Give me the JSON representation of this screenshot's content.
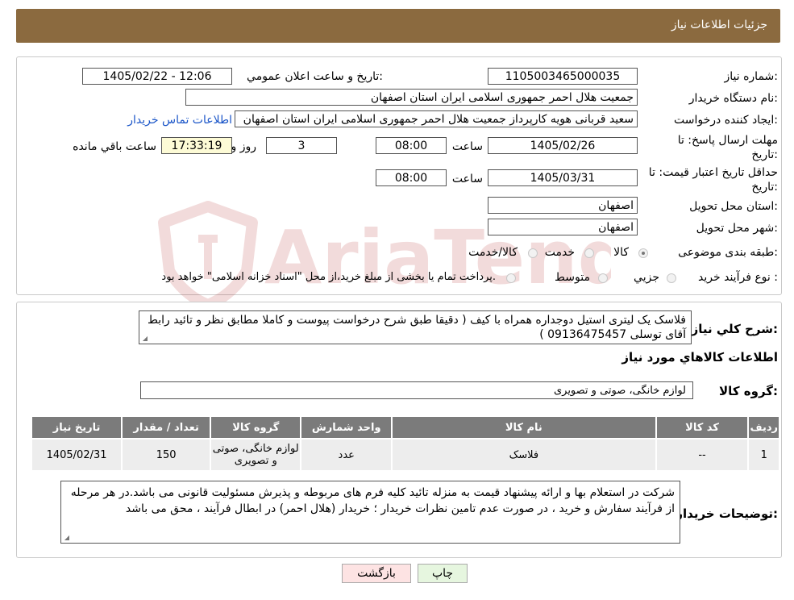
{
  "header": {
    "title": "جزئیات اطلاعات نیاز"
  },
  "form": {
    "need_number_label": "شماره نیاز:",
    "need_number": "1105003465000035",
    "announce_label": "تاریخ و ساعت اعلان عمومي:",
    "announce_value": "1405/02/22 - 12:06",
    "buyer_org_label": "نام دستگاه خریدار:",
    "buyer_org": "جمعیت هلال احمر جمهوری اسلامی ایران استان اصفهان",
    "creator_label": "ایجاد کننده درخواست:",
    "creator": "سعید قربانی هویه کارپرداز جمعیت هلال احمر جمهوری اسلامی ایران استان اصفهان",
    "contact_link": "اطلاعات تماس خریدار",
    "deadline_label_1": "مهلت ارسال پاسخ: تا",
    "deadline_label_2": "تاریخ:",
    "deadline_date": "1405/02/26",
    "time_label": "ساعت",
    "deadline_time": "08:00",
    "days_value": "3",
    "days_label": "روز و",
    "remaining_time": "17:33:19",
    "remaining_label": "ساعت باقي مانده",
    "price_validity_label_1": "حداقل تاریخ اعتبار قیمت: تا",
    "price_validity_label_2": "تاریخ:",
    "price_validity_date": "1405/03/31",
    "price_validity_time": "08:00",
    "province_label": "استان محل تحویل:",
    "province": "اصفهان",
    "city_label": "شهر محل تحویل:",
    "city": "اصفهان",
    "category_label": "طبقه بندی موضوعی:",
    "category_options": [
      "کالا",
      "خدمت",
      "کالا/خدمت"
    ],
    "category_selected": "کالا",
    "process_label": "نوع فرآیند خرید :",
    "process_options": [
      "جزيي",
      "متوسط"
    ],
    "process_note": "پرداخت تمام یا بخشی از مبلغ خرید،از محل \"اسناد خزانه اسلامی\" خواهد بود."
  },
  "summary": {
    "label": "شرح كلي نياز:",
    "text": "فلاسک یک لیتری استیل دوجداره همراه با کیف ( دقیقا طبق شرح درخواست پیوست و کاملا مطابق نظر و تائید رابط آقای توسلی 09136475457 )",
    "goods_info_title": "اطلاعات كالاهاي مورد نياز",
    "goods_group_label": "گروه كالا:",
    "goods_group": "لوازم خانگی، صوتی و تصویری"
  },
  "table": {
    "headers": [
      "رديف",
      "كد كالا",
      "نام كالا",
      "واحد شمارش",
      "گروه كالا",
      "تعداد / مقدار",
      "تاريخ نياز"
    ],
    "rows": [
      {
        "row": "1",
        "code": "--",
        "name": "فلاسک",
        "unit": "عدد",
        "group": "لوازم خانگی، صوتی و تصویری",
        "qty": "150",
        "date": "1405/02/31"
      }
    ]
  },
  "notes": {
    "label": "توضيحات خريدار:",
    "text": "شرکت در استعلام بها و ارائه پیشنهاد قیمت به منزله تائید کلیه فرم های مربوطه و پذیرش مسئولیت قانونی می باشد.در هر مرحله از فرآیند سفارش و خرید ، در صورت عدم تامین نظرات خریدار ؛ خریدار (هلال احمر) در ابطال فرآیند ، محق می باشد"
  },
  "buttons": {
    "print": "چاپ",
    "back": "بازگشت"
  },
  "watermark": {
    "text": "AriaTender.neT"
  },
  "colors": {
    "header_bg": "#8b6a3f",
    "link": "#1a55c8",
    "table_header": "#7b7b7b",
    "back_button_bg": "#fde3e3",
    "print_button_bg": "#e6f6df",
    "remaining_bg": "#fdfbd6"
  }
}
